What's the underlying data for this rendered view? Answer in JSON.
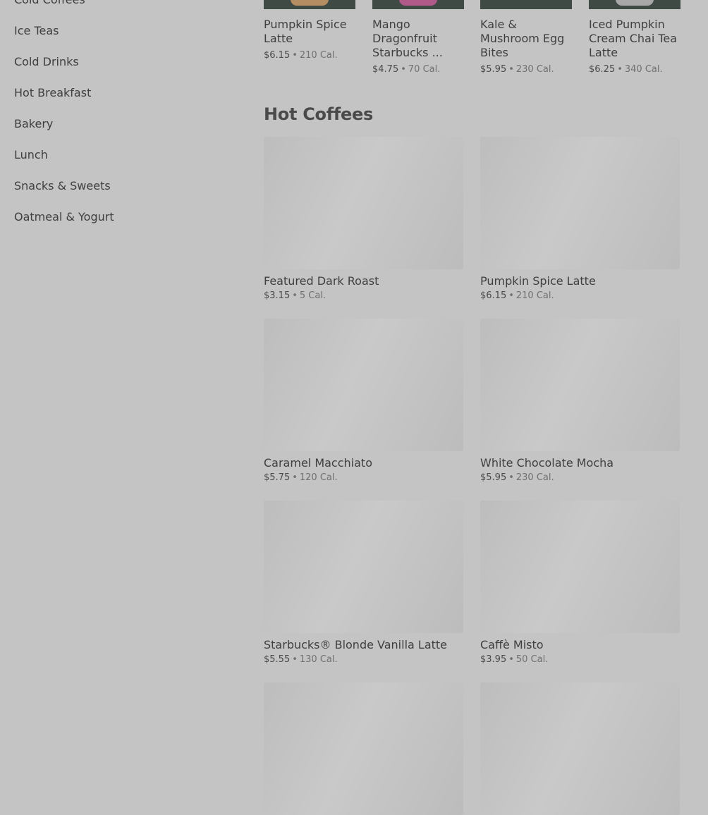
{
  "sidebar": {
    "items": [
      {
        "label": "Cold Coffees"
      },
      {
        "label": "Ice Teas"
      },
      {
        "label": "Cold Drinks"
      },
      {
        "label": "Hot Breakfast"
      },
      {
        "label": "Bakery"
      },
      {
        "label": "Lunch"
      },
      {
        "label": "Snacks & Sweets"
      },
      {
        "label": "Oatmeal & Yogurt"
      }
    ]
  },
  "featured": [
    {
      "name": "Pumpkin Spice Latte",
      "price": "$6.15",
      "calories": "210 Cal.",
      "thumb_color": "#b58d63"
    },
    {
      "name": "Mango Dragonfruit Starbucks ...",
      "price": "$4.75",
      "calories": "70 Cal.",
      "thumb_color": "#b05a8a"
    },
    {
      "name": "Kale & Mushroom Egg Bites",
      "price": "$5.95",
      "calories": "230 Cal.",
      "thumb_color": "#3f4a45"
    },
    {
      "name": "Iced Pumpkin Cream Chai Tea Latte",
      "price": "$6.25",
      "calories": "340 Cal.",
      "thumb_color": "#a8a8a8"
    }
  ],
  "section": {
    "title": "Hot Coffees",
    "items": [
      {
        "name": "Featured Dark Roast",
        "price": "$3.15",
        "calories": "5 Cal."
      },
      {
        "name": "Pumpkin Spice Latte",
        "price": "$6.15",
        "calories": "210 Cal."
      },
      {
        "name": "Caramel Macchiato",
        "price": "$5.75",
        "calories": "120 Cal."
      },
      {
        "name": "White Chocolate Mocha",
        "price": "$5.95",
        "calories": "230 Cal."
      },
      {
        "name": "Starbucks® Blonde Vanilla Latte",
        "price": "$5.55",
        "calories": "130 Cal."
      },
      {
        "name": "Caffè Misto",
        "price": "$3.95",
        "calories": "50 Cal."
      },
      {
        "name": "",
        "price": "",
        "calories": ""
      },
      {
        "name": "",
        "price": "",
        "calories": ""
      }
    ]
  },
  "separator": "•",
  "colors": {
    "background": "#c4c4c4",
    "thumb_dark": "#3f4a45",
    "text": "#3f3f3f"
  }
}
